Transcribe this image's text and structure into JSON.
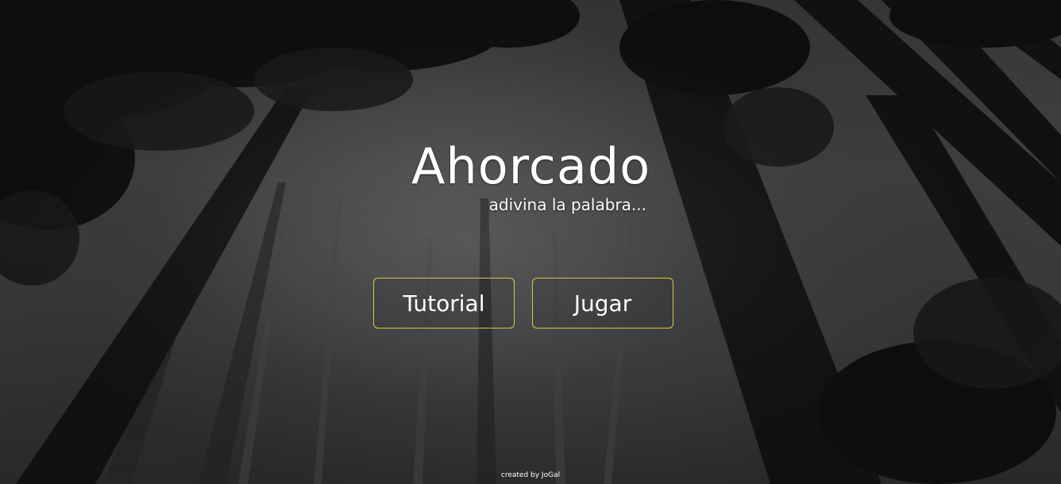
{
  "header": {
    "title": "Ahorcado",
    "subtitle": "adivina la palabra..."
  },
  "menu": {
    "tutorial_label": "Tutorial",
    "play_label": "Jugar",
    "button_border_color": "#d8c74a"
  },
  "footer": {
    "credit": "created by JoGal"
  },
  "background": {
    "scene": "foggy-forest-looking-up",
    "tint": "#3d3d3d"
  }
}
